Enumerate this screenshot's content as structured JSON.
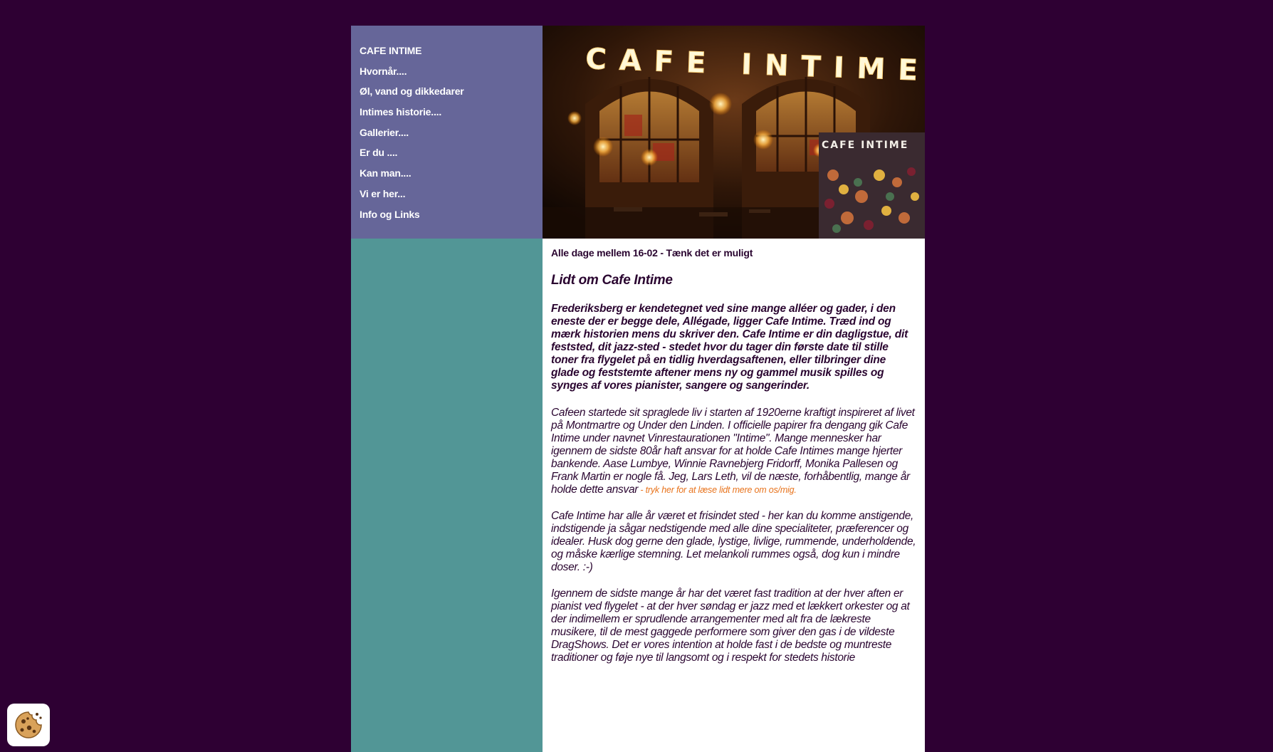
{
  "nav": {
    "items": [
      {
        "label": "CAFE INTIME"
      },
      {
        "label": "Hvornår...."
      },
      {
        "label": "Øl, vand og dikkedarer"
      },
      {
        "label": "Intimes historie...."
      },
      {
        "label": "Gallerier...."
      },
      {
        "label": "Er du ...."
      },
      {
        "label": "Kan man...."
      },
      {
        "label": "Vi er her..."
      },
      {
        "label": "Info og Links"
      }
    ]
  },
  "header": {
    "sign_text": "CAFE INTIME",
    "inset_sign_text": "CAFE INTIME"
  },
  "content": {
    "hours": "Alle dage mellem 16-02 - Tænk det er muligt",
    "heading": "Lidt om Cafe Intime",
    "lead": "Frederiksberg er kendetegnet ved sine mange alléer og gader, i den eneste der er begge dele, Allégade, ligger Cafe Intime. Træd ind og mærk historien mens du skriver den. Cafe Intime er din dagligstue, dit feststed, dit jazz-sted - stedet hvor du tager din første date til stille toner fra flygelet på en tidlig hverdagsaftenen, eller tilbringer dine glade og feststemte aftener mens ny og gammel musik spilles og synges af vores pianister, sangere og sangerinder.",
    "para1": "Cafeen startede sit spraglede liv i starten af 1920erne kraftigt inspireret af livet på Montmartre og Under den Linden. I officielle papirer fra dengang gik Cafe Intime under navnet Vinrestaurationen \"Intime\". Mange mennesker har igennem de sidste 80år haft ansvar for at holde Cafe Intimes mange hjerter bankende. Aase Lumbye, Winnie Ravnebjerg Fridorff, Monika Pallesen og Frank Martin er nogle få. Jeg, Lars Leth, vil de næste, forhåbentlig, mange år holde dette ansvar",
    "para1_link": " - tryk her for at læse lidt mere om os/mig.",
    "para2": "Cafe Intime har alle år været et frisindet sted - her kan du komme anstigende, indstigende ja sågar nedstigende med alle dine specialiteter, præferencer og idealer. Husk dog gerne den glade, lystige, livlige, rummende, underholdende, og måske kærlige stemning. Let melankoli rummes også, dog kun i mindre doser. :-)",
    "para3": "Igennem de sidste mange år har det været fast tradition at der hver aften er pianist ved flygelet - at der hver søndag er jazz med et lækkert orkester og at der indimellem er sprudlende arrangementer med alt fra de lækreste musikere, til de mest gaggede performere som giver den gas i de vildeste DragShows. Det er vores intention at holde fast i de bedste og muntreste traditioner og føje nye til langsomt og i respekt for stedets historie"
  },
  "colors": {
    "background": "#2e0033",
    "sidebar": "#666699",
    "sidebar_lower": "#529696",
    "content_bg": "#ffffff",
    "link": "#e8731c"
  },
  "icons": {
    "cookie": "cookie-icon"
  }
}
